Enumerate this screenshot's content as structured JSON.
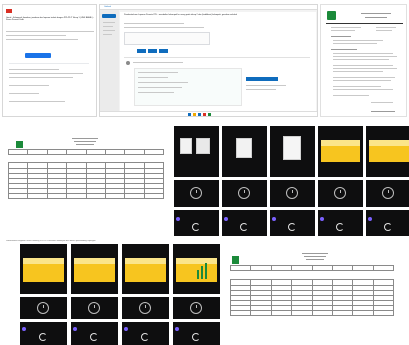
{
  "email_panel": {
    "subject": "Gmail - Kelompok Jawaban, jawaban dan laporan terkait dengan PPL/PLP Tahap 1 (LINK BATAL) - Siswa Peserta Didik",
    "button": "Lihat"
  },
  "outlook_panel": {
    "brand": "Outlook",
    "new_mail": "New mail",
    "subject": "Pemberitahuan Laporan Peserta PPL - mendaftar kelompok ke ruang pada tahap 2 dan (kodifikasi) kelompok, gunakan sekolah",
    "link_text": "Lihat laporan"
  },
  "letter_doc": {
    "heading": "Konsep Kajian",
    "body_intro": "Berikut rincian pengajuan lokasi PPL dan daftar tugas kelompok:",
    "signature": "Koordinator"
  },
  "attendance_doc_left": {
    "title_lines": [
      "DAFTAR HADIR",
      "KEGIATAN PPL",
      "SEKOLAH DASAR"
    ],
    "columns": [
      "No",
      "Nama",
      "NIM",
      "Program Studi",
      "Kelas",
      "Mata Kuliah",
      "Paraf",
      "Ket"
    ]
  },
  "attendance_doc_right": {
    "title_lines": [
      "DAFTAR HADIR",
      "KEGIATAN PPL",
      "SEKOLAH DASAR"
    ],
    "columns": [
      "No",
      "Nama",
      "NIM",
      "Program Studi",
      "Kelas",
      "Mata Kuliah",
      "Paraf",
      "Ket"
    ]
  },
  "caption_bottom_left": "Dokumentasi kegiatan virtual meeting PPL/PLP bersama kelompok dan dosen pembimbing lapangan",
  "colors": {
    "gmail_red": "#d93025",
    "outlook_blue": "#0f6cbd",
    "meet_dark": "#0e0e0f",
    "slide_yellow": "#f7c51f",
    "avatar_purple": "#7b61ff",
    "logo_green": "#1b8a3a"
  }
}
